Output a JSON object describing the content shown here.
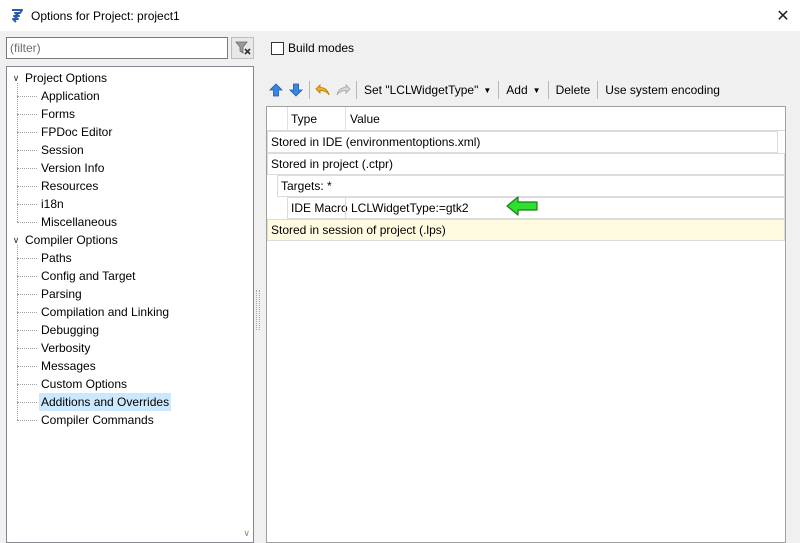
{
  "window": {
    "title": "Options for Project: project1",
    "close_glyph": "✕",
    "icon": "lazarus-icon"
  },
  "filter": {
    "placeholder": "(filter)",
    "clear_icon": "clear-filter-icon"
  },
  "tree": {
    "groups": [
      {
        "label": "Project Options",
        "expanded": true,
        "children": [
          "Application",
          "Forms",
          "FPDoc Editor",
          "Session",
          "Version Info",
          "Resources",
          "i18n",
          "Miscellaneous"
        ]
      },
      {
        "label": "Compiler Options",
        "expanded": true,
        "children": [
          "Paths",
          "Config and Target",
          "Parsing",
          "Compilation and Linking",
          "Debugging",
          "Verbosity",
          "Messages",
          "Custom Options",
          "Additions and Overrides",
          "Compiler Commands"
        ]
      }
    ],
    "selected": "Additions and Overrides"
  },
  "build_modes": {
    "label": "Build modes",
    "checked": false
  },
  "toolbar": {
    "move_up_icon": "arrow-up-icon",
    "move_down_icon": "arrow-down-icon",
    "undo_icon": "undo-icon",
    "redo_icon": "redo-icon",
    "set_label": "Set \"LCLWidgetType\"",
    "add_label": "Add",
    "delete_label": "Delete",
    "encoding_label": "Use system encoding"
  },
  "grid": {
    "columns": [
      "Type",
      "Value"
    ],
    "rows": {
      "ide": "Stored in IDE (environmentoptions.xml)",
      "project": "Stored in project (.ctpr)",
      "targets": "Targets: *",
      "macro_type": "IDE Macro",
      "macro_value": "LCLWidgetType:=gtk2",
      "session": "Stored in session of project (.lps)"
    }
  },
  "colors": {
    "selection": "#cce8ff",
    "arrow_fill": "#22dd22",
    "arrow_up": "#2b7de0",
    "undo": "#e0a020"
  }
}
